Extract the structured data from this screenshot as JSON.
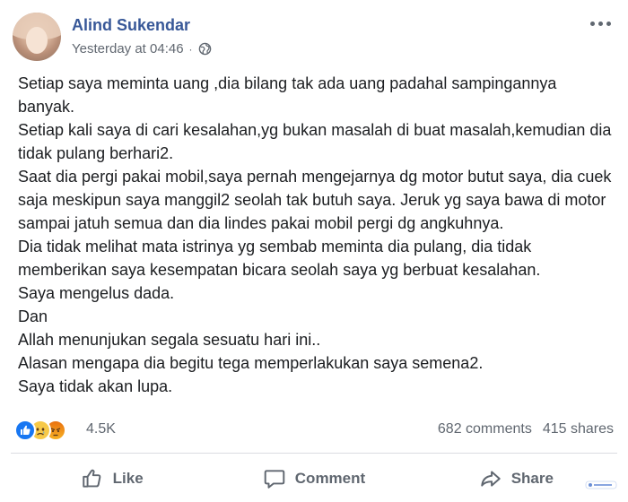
{
  "post": {
    "author": "Alind Sukendar",
    "timestamp": "Yesterday at 04:46",
    "separator": "·",
    "privacy_icon": "globe-icon",
    "lines": [
      "Setiap saya meminta uang ,dia bilang tak ada uang padahal sampingannya banyak.",
      "Setiap kali saya di cari kesalahan,yg bukan masalah di buat masalah,kemudian dia tidak pulang berhari2.",
      "Saat dia pergi pakai mobil,saya pernah mengejarnya dg motor butut saya, dia cuek saja meskipun saya manggil2 seolah tak butuh saya. Jeruk yg saya bawa di motor sampai jatuh semua dan dia lindes pakai mobil pergi dg angkuhnya.",
      "Dia tidak melihat mata istrinya yg sembab meminta dia pulang, dia tidak memberikan saya kesempatan bicara seolah saya yg berbuat kesalahan.",
      "Saya mengelus dada.",
      "Dan",
      "Allah menunjukan segala sesuatu hari ini..",
      "Alasan mengapa dia begitu tega memperlakukan saya semena2.",
      "Saya tidak akan lupa."
    ]
  },
  "reactions": {
    "icons": [
      "like-reaction-icon",
      "sad-reaction-icon",
      "angry-reaction-icon"
    ],
    "count": "4.5K",
    "comments": "682 comments",
    "shares": "415 shares"
  },
  "actions": {
    "like": "Like",
    "comment": "Comment",
    "share": "Share"
  },
  "colors": {
    "author": "#385898",
    "meta": "#606770",
    "text": "#1c1e21",
    "like_blue": "#1877f2"
  }
}
